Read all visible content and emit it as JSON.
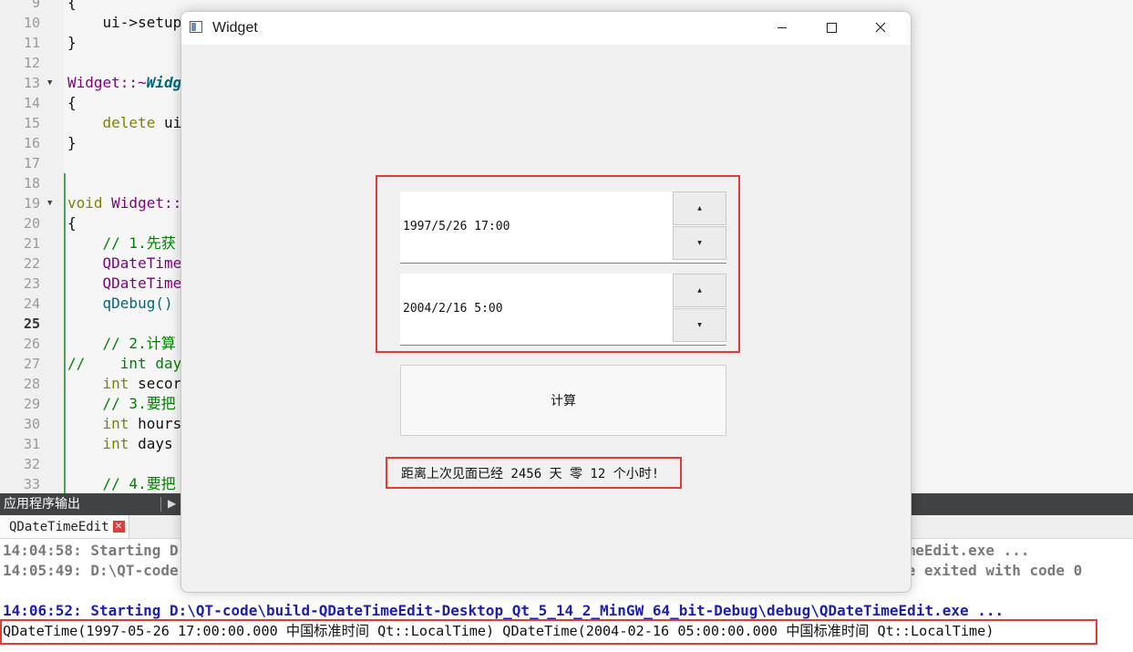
{
  "editor": {
    "line_numbers": [
      "9",
      "10",
      "11",
      "12",
      "13",
      "14",
      "15",
      "16",
      "17",
      "18",
      "19",
      "20",
      "21",
      "22",
      "23",
      "24",
      "25",
      "26",
      "27",
      "28",
      "29",
      "30",
      "31",
      "32",
      "33"
    ],
    "current_line": "25",
    "code": {
      "l9": "{",
      "l10_indent": "    ",
      "l10": "ui->setup",
      "l11": "}",
      "l13_a": "Widget::~",
      "l13_b": "Widg",
      "l14": "{",
      "l15_indent": "    ",
      "l15_kw": "delete",
      "l15_rest": " ui",
      "l16": "}",
      "l19_kw": "void",
      "l19_rest": " Widget::",
      "l20": "{",
      "l21": "    // 1.先获",
      "l22": "    QDateTime",
      "l23": "    QDateTime",
      "l24": "    qDebug()",
      "l26": "    // 2.计算",
      "l27": "//    int day",
      "l28_indent": "    ",
      "l28_kw": "int",
      "l28_rest": " secor",
      "l29": "    // 3.要把",
      "l30_indent": "    ",
      "l30_kw": "int",
      "l30_rest": " hours",
      "l31_indent": "    ",
      "l31_kw": "int",
      "l31_rest": " days",
      "l33": "    // 4.要把"
    }
  },
  "output_panel": {
    "title": "应用程序输出",
    "tab_label": "QDateTimeEdit",
    "tab_close": "✕",
    "lines": {
      "l1_a": "14:04:58: Starting D",
      "l1_b": "imeEdit.exe ...",
      "l2_a": "14:05:49: D:\\QT-code",
      "l2_b": "xe exited with code 0",
      "l3": "14:06:52: Starting D:\\QT-code\\build-QDateTimeEdit-Desktop_Qt_5_14_2_MinGW_64_bit-Debug\\debug\\QDateTimeEdit.exe ...",
      "l4": "QDateTime(1997-05-26 17:00:00.000 中国标准时间 Qt::LocalTime) QDateTime(2004-02-16 05:00:00.000 中国标准时间 Qt::LocalTime)"
    }
  },
  "widget_window": {
    "title": "Widget",
    "datetime_edit_1": "1997/5/26 17:00",
    "datetime_edit_2": "2004/2/16 5:00",
    "spin_up": "▲",
    "spin_down": "▼",
    "calculate_button": "计算",
    "result_text": "距离上次见面已经 2456 天 零 12 个小时!"
  },
  "colors": {
    "highlight": "#e53935",
    "output_blue": "#1d1db0",
    "comment_green": "#008000",
    "keyword_olive": "#808000"
  }
}
